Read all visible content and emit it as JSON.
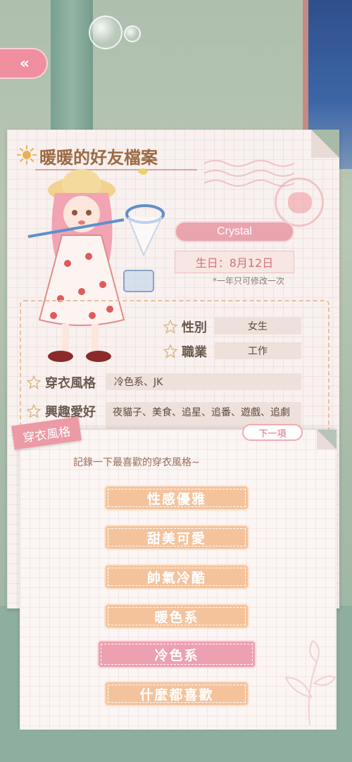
{
  "back_button": {
    "label": "«"
  },
  "profile": {
    "title": "暖暖的好友檔案",
    "name": "Crystal",
    "birthday": "生日：8月12日",
    "birthday_note": "*一年只可修改一次",
    "fields": {
      "gender": {
        "label": "性別",
        "value": "女生"
      },
      "job": {
        "label": "職業",
        "value": "工作"
      },
      "style": {
        "label": "穿衣風格",
        "value": "冷色系、JK"
      },
      "hobby": {
        "label": "興趣愛好",
        "value": "夜貓子、美食、追星、追番、遊戲、追劇"
      }
    }
  },
  "dialog": {
    "tag": "穿衣風格",
    "next": "下一項",
    "prompt": "記錄一下最喜歡的穿衣風格~",
    "options": [
      "性感優雅",
      "甜美可愛",
      "帥氣冷酷",
      "暖色系",
      "冷色系",
      "什麼都喜歡"
    ],
    "selected_index": 4
  },
  "colors": {
    "accent_pink": "#eda0b0",
    "option_orange": "#f4c39c",
    "title_brown": "#9b6a43"
  }
}
